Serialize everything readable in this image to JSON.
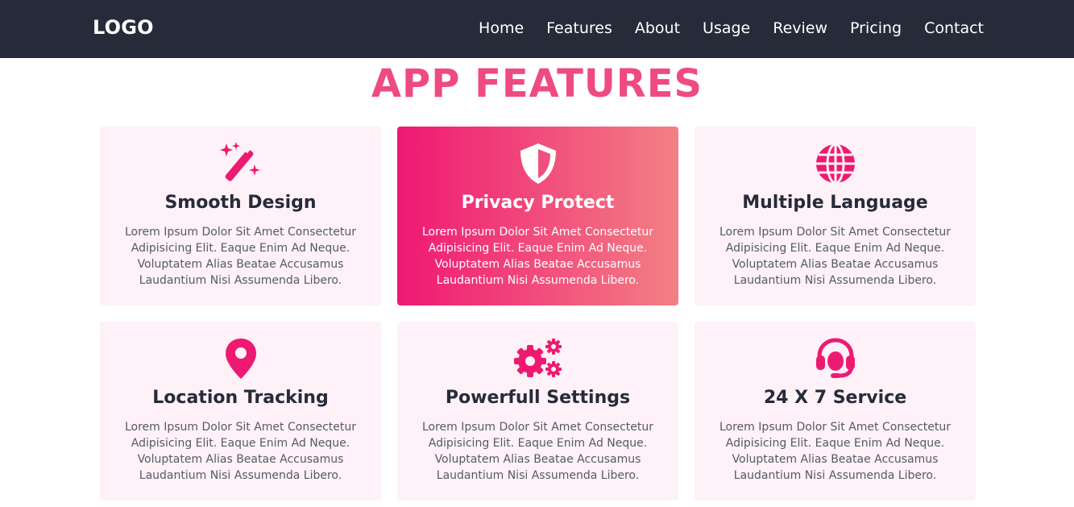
{
  "nav": {
    "logo": "LOGO",
    "links": [
      "Home",
      "Features",
      "About",
      "Usage",
      "Review",
      "Pricing",
      "Contact"
    ]
  },
  "section": {
    "title": "APP FEATURES"
  },
  "cards": [
    {
      "title": "Smooth Design",
      "icon": "magic-wand-icon",
      "text": "Lorem Ipsum Dolor Sit Amet Consectetur Adipisicing Elit. Eaque Enim Ad Neque. Voluptatem Alias Beatae Accusamus Laudantium Nisi Assumenda Libero."
    },
    {
      "title": "Privacy Protect",
      "icon": "shield-icon",
      "text": "Lorem Ipsum Dolor Sit Amet Consectetur Adipisicing Elit. Eaque Enim Ad Neque. Voluptatem Alias Beatae Accusamus Laudantium Nisi Assumenda Libero."
    },
    {
      "title": "Multiple Language",
      "icon": "globe-icon",
      "text": "Lorem Ipsum Dolor Sit Amet Consectetur Adipisicing Elit. Eaque Enim Ad Neque. Voluptatem Alias Beatae Accusamus Laudantium Nisi Assumenda Libero."
    },
    {
      "title": "Location Tracking",
      "icon": "map-pin-icon",
      "text": "Lorem Ipsum Dolor Sit Amet Consectetur Adipisicing Elit. Eaque Enim Ad Neque. Voluptatem Alias Beatae Accusamus Laudantium Nisi Assumenda Libero."
    },
    {
      "title": "Powerfull Settings",
      "icon": "gears-icon",
      "text": "Lorem Ipsum Dolor Sit Amet Consectetur Adipisicing Elit. Eaque Enim Ad Neque. Voluptatem Alias Beatae Accusamus Laudantium Nisi Assumenda Libero."
    },
    {
      "title": "24 X 7 Service",
      "icon": "headset-icon",
      "text": "Lorem Ipsum Dolor Sit Amet Consectetur Adipisicing Elit. Eaque Enim Ad Neque. Voluptatem Alias Beatae Accusamus Laudantium Nisi Assumenda Libero."
    }
  ],
  "colors": {
    "navbar_bg": "#262b39",
    "accent": "#ef4a82",
    "icon": "#ee1a72",
    "card_bg": "#fef1f7",
    "active_gradient_start": "#ef1873",
    "active_gradient_end": "#f38084"
  }
}
